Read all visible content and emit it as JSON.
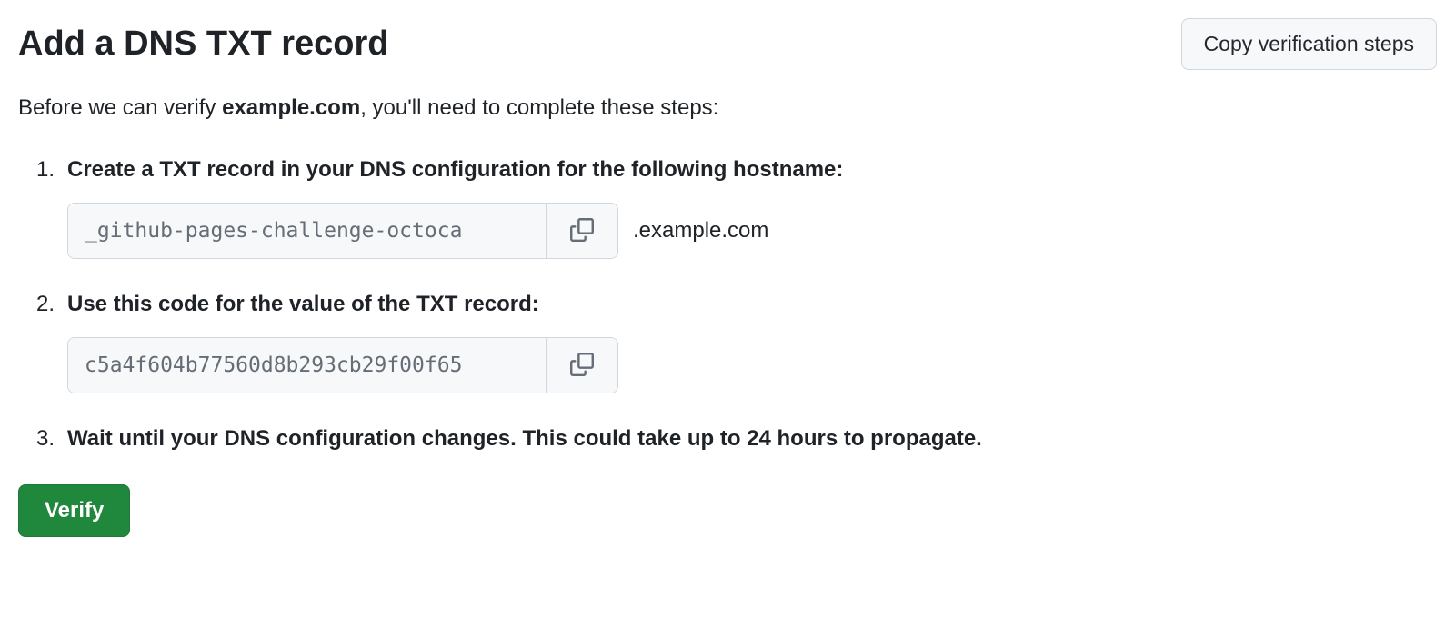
{
  "header": {
    "title": "Add a DNS TXT record",
    "copy_steps_label": "Copy verification steps"
  },
  "intro": {
    "before": "Before we can verify ",
    "domain": "example.com",
    "after": ", you'll need to complete these steps:"
  },
  "steps": {
    "step1": {
      "heading": "Create a TXT record in your DNS configuration for the following hostname:",
      "hostname_value": "_github-pages-challenge-octoca",
      "domain_suffix": ".example.com"
    },
    "step2": {
      "heading": "Use this code for the value of the TXT record:",
      "code_value": "c5a4f604b77560d8b293cb29f00f65"
    },
    "step3": {
      "heading": "Wait until your DNS configuration changes. This could take up to 24 hours to propagate."
    }
  },
  "actions": {
    "verify_label": "Verify"
  }
}
